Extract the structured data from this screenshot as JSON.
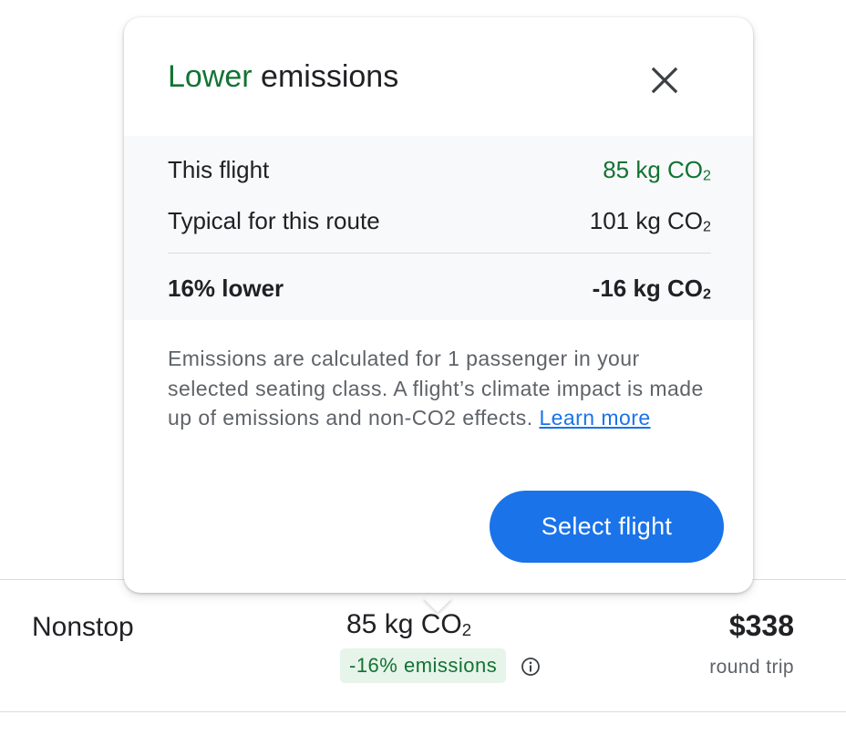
{
  "popup": {
    "title_accent": "Lower",
    "title_rest": " emissions",
    "close_icon": "close-icon",
    "rows": [
      {
        "label": "This flight",
        "value": "85 kg CO",
        "sub": "2",
        "value_color": "#137333"
      },
      {
        "label": "Typical for this route",
        "value": "101 kg CO",
        "sub": "2"
      },
      {
        "label": "16% lower",
        "value": "-16 kg CO",
        "sub": "2"
      }
    ],
    "description": "Emissions are calculated for 1 passenger in your selected seating class. A flight’s climate impact is made up of emissions and non-CO2 effects. ",
    "learn_more": "Learn more",
    "select_button": "Select flight"
  },
  "flight": {
    "stops": "Nonstop",
    "emissions_value": "85 kg CO",
    "emissions_sub": "2",
    "emissions_badge": "-16% emissions",
    "info_icon": "info-icon",
    "price": "$338",
    "trip_type": "round trip"
  },
  "colors": {
    "accent_green": "#137333",
    "badge_bg": "#e6f4ea",
    "primary_blue": "#1a73e8"
  }
}
